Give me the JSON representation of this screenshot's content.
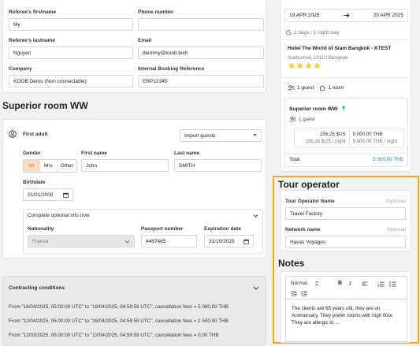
{
  "referee": {
    "firstname_label": "Referee's firstname",
    "firstname_value": "My",
    "phone_label": "Phone number",
    "phone_value": "",
    "lastname_label": "Referee's lastname",
    "lastname_value": "Nguyen",
    "email_label": "Email",
    "email_value": "diemmy@koob.tech",
    "company_label": "Company",
    "company_value": "KOOB Demo (Non connectable)",
    "internal_ref_label": "Internal Booking Reference",
    "internal_ref_value": "ERP12345"
  },
  "room": {
    "title": "Superior room WW",
    "adult_title": "First adult",
    "import_guests": "Import guests",
    "gender_label": "Gender",
    "gender_options": [
      "Mr",
      "Mrs",
      "Other"
    ],
    "gender_selected": "Mr",
    "firstname_label": "First name",
    "firstname_value": "John",
    "lastname_label": "Last name",
    "lastname_value": "SMITH",
    "birthdate_label": "Birthdate",
    "birthdate_value": "01/01/2000",
    "optional_info": "Complete optional info now",
    "nationality_label": "Nationality",
    "nationality_value": "France",
    "passport_label": "Passport number",
    "passport_value": "4487465",
    "expiration_label": "Expiration date",
    "expiration_value": "31/10/2025"
  },
  "contracting": {
    "title": "Contracting conditions",
    "lines": [
      "From \"16/04/2025, 05:00:00 UTC\" to \"19/04/2025, 04:59:59 UTC\", cancellation fees = 5 000,00 THB",
      "From \"12/04/2025, 05:00:00 UTC\" to \"16/04/2025, 04:59:59 UTC\", cancellation fees = 2 500,00 THB",
      "From \"12/03/2025, 05:00:00 UTC\" to \"12/04/2025, 04:59:59 UTC\", cancellation fees = 0,00 THB"
    ]
  },
  "summary": {
    "date_from": "19 APR 2025",
    "date_to": "20 APR 2025",
    "stay": "2 days / 1 night stay",
    "hotel_name": "Hotel The World of Siam Bangkok - KTEST",
    "hotel_address": "Sukhumvit, 10110 Bangkok",
    "stars": 4,
    "guests": "1 guest",
    "rooms": "1 room",
    "room_name": "Superior room WW",
    "room_guests": "1 guest",
    "price_usd": "156,25 $US",
    "price_usd_night": "156,25 $US / night",
    "price_thb": "5 000,00 THB",
    "price_thb_night": "5 000,00 THB / night",
    "total_label": "Total",
    "total_value": "5 000,00 THB"
  },
  "tour_operator": {
    "title": "Tour operator",
    "name_label": "Tour Operator Name",
    "name_optional": "Optional",
    "name_value": "Travel Factory",
    "network_label": "Network name",
    "network_optional": "Optional",
    "network_value": "Havas Voyages"
  },
  "notes": {
    "title": "Notes",
    "format_select": "Normal",
    "bold": "B",
    "italic": "I",
    "text": "The clients are 65 years old, they are on Anniversary. They prefer rooms with high floor. They are allergic to ..."
  },
  "colors": {
    "accent": "#f5a623",
    "link": "#2a7ae2",
    "star": "#f5c518",
    "gender_selected_bg": "#fcdcc6",
    "gender_selected_text": "#e07a3a",
    "leaf": "#22b573"
  }
}
